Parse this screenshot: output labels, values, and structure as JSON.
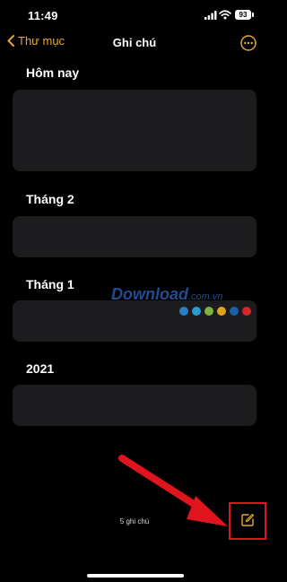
{
  "status_bar": {
    "time": "11:49",
    "battery_level": "93",
    "icons": [
      "signal-icon",
      "wifi-icon",
      "battery-icon"
    ]
  },
  "nav": {
    "back_label": "Thư mục",
    "title": "Ghi chú",
    "more_icon": "ellipsis-circle-icon"
  },
  "sections": [
    {
      "title": "Hôm nay"
    },
    {
      "title": "Tháng 2"
    },
    {
      "title": "Tháng 1"
    },
    {
      "title": "2021"
    }
  ],
  "watermark": {
    "brand": "Download",
    "domain": ".com.vn"
  },
  "footer": {
    "note_count": "5 ghi chú",
    "compose_icon": "compose-icon"
  },
  "colors": {
    "accent": "#e5a82e",
    "card_background": "#1c1c1e",
    "highlight": "#e0141c",
    "watermark": "#2a5aa8"
  }
}
